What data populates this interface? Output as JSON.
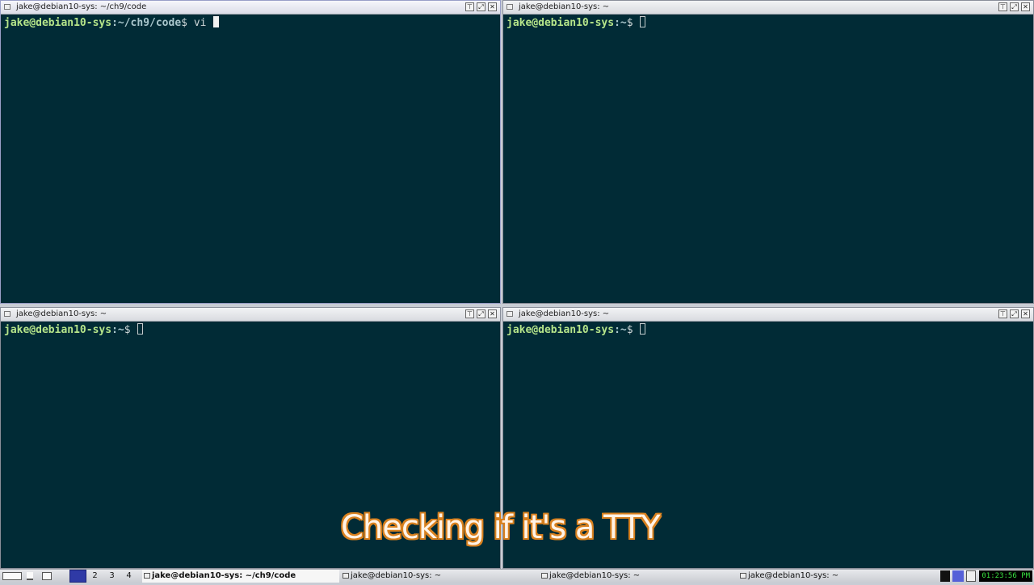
{
  "windows": {
    "top_left": {
      "title": "jake@debian10-sys: ~/ch9/code",
      "user_host": "jake@debian10-sys",
      "path": ":~/ch9/code",
      "symbol": "$ ",
      "command": "vi "
    },
    "top_right": {
      "title": "jake@debian10-sys: ~",
      "user_host": "jake@debian10-sys",
      "path": ":~",
      "symbol": "$ ",
      "command": ""
    },
    "bottom_left": {
      "title": "jake@debian10-sys: ~",
      "user_host": "jake@debian10-sys",
      "path": ":~",
      "symbol": "$ ",
      "command": ""
    },
    "bottom_right": {
      "title": "jake@debian10-sys: ~",
      "user_host": "jake@debian10-sys",
      "path": ":~",
      "symbol": "$ ",
      "command": ""
    }
  },
  "window_buttons": {
    "shade": "⊤",
    "maximize": "⤢",
    "close": "✕"
  },
  "caption": "Checking if it's a TTY",
  "taskbar": {
    "desktops": [
      "",
      "2",
      "3",
      "4"
    ],
    "tasks": [
      "jake@debian10-sys: ~/ch9/code",
      "jake@debian10-sys: ~",
      "jake@debian10-sys: ~",
      "jake@debian10-sys: ~"
    ],
    "clock": "01:23:56 PM"
  },
  "colors": {
    "terminal_bg": "#012b36",
    "prompt_green": "#b6e58a",
    "caption_outline": "#d8801e",
    "clock_green": "#38e040"
  }
}
